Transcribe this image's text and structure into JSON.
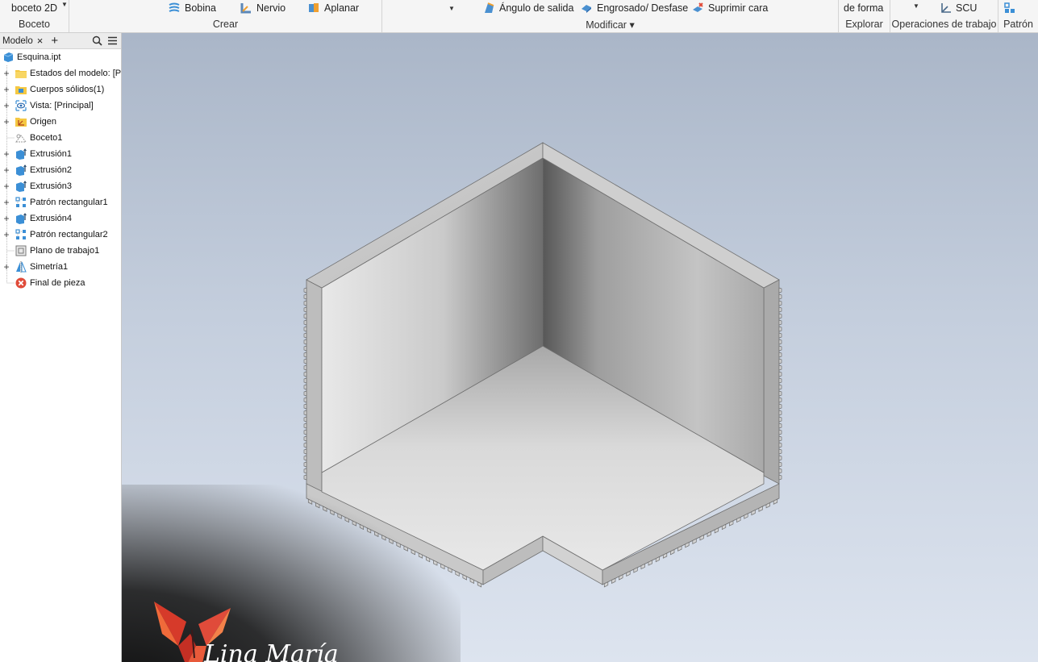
{
  "ribbon": {
    "boceto": {
      "button": "boceto 2D",
      "label": "Boceto"
    },
    "crear": {
      "bobina": "Bobina",
      "nervio": "Nervio",
      "aplanar": "Aplanar",
      "label": "Crear"
    },
    "modificar": {
      "angulo": "Ángulo de salida",
      "engrosado": "Engrosado/ Desfase",
      "suprimir": "Suprimir cara",
      "label": "Modificar ▾"
    },
    "explorar": {
      "button": "de forma",
      "label": "Explorar"
    },
    "operaciones": {
      "scu": "SCU",
      "label": "Operaciones de trabajo"
    },
    "patron": {
      "label": "Patrón"
    }
  },
  "browser": {
    "tab": "Modelo",
    "close": "×",
    "add": "+",
    "items": [
      {
        "label": "Esquina.ipt",
        "icon": "part-icon"
      },
      {
        "label": "Estados del modelo: [Principal]",
        "icon": "folder-icon"
      },
      {
        "label": "Cuerpos sólidos(1)",
        "icon": "solid-bodies-folder-icon"
      },
      {
        "label": "Vista: [Principal]",
        "icon": "view-eye-icon"
      },
      {
        "label": "Origen",
        "icon": "origin-folder-icon"
      },
      {
        "label": "Boceto1",
        "icon": "sketch-icon"
      },
      {
        "label": "Extrusión1",
        "icon": "extrude-icon"
      },
      {
        "label": "Extrusión2",
        "icon": "extrude-icon"
      },
      {
        "label": "Extrusión3",
        "icon": "extrude-icon"
      },
      {
        "label": "Patrón rectangular1",
        "icon": "rectangular-pattern-icon"
      },
      {
        "label": "Extrusión4",
        "icon": "extrude-icon"
      },
      {
        "label": "Patrón rectangular2",
        "icon": "rectangular-pattern-icon"
      },
      {
        "label": "Plano de trabajo1",
        "icon": "work-plane-icon"
      },
      {
        "label": "Simetría1",
        "icon": "mirror-icon"
      },
      {
        "label": "Final de pieza",
        "icon": "end-of-part-icon"
      }
    ]
  },
  "watermark": {
    "text": "Lina María"
  },
  "colors": {
    "viewport_top": "#aab6c8",
    "viewport_bottom": "#dde4ef",
    "end_of_part": "#e04b3a",
    "extrude_blue": "#3b8fd6"
  }
}
